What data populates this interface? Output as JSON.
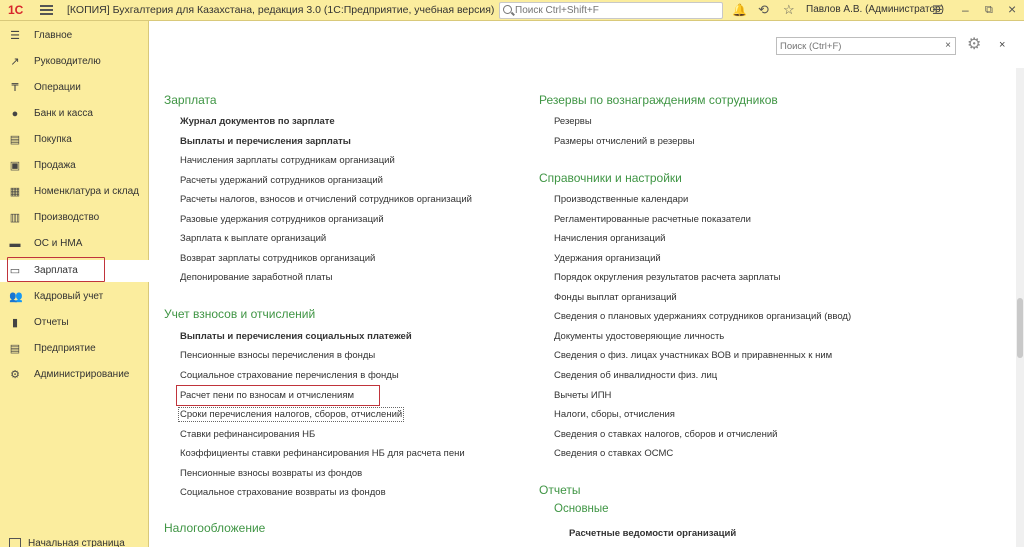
{
  "titlebar": {
    "logo": "1С",
    "title": "[КОПИЯ] Бухгалтерия для Казахстана, редакция 3.0  (1С:Предприятие, учебная версия)",
    "search_placeholder": "Поиск Ctrl+Shift+F",
    "user": "Павлов А.В. (Администратор)",
    "icons": {
      "bell": "🔔",
      "history": "⟲",
      "star": "☆",
      "menu": "☰",
      "minimize": "–",
      "restore": "⧉",
      "close": "×"
    }
  },
  "sidebar": {
    "items": [
      {
        "label": "Главное",
        "icon": "☰"
      },
      {
        "label": "Руководителю",
        "icon": "↗"
      },
      {
        "label": "Операции",
        "icon": "₸"
      },
      {
        "label": "Банк и касса",
        "icon": "●"
      },
      {
        "label": "Покупка",
        "icon": "▤"
      },
      {
        "label": "Продажа",
        "icon": "▣"
      },
      {
        "label": "Номенклатура и склад",
        "icon": "▦"
      },
      {
        "label": "Производство",
        "icon": "▥"
      },
      {
        "label": "ОС и НМА",
        "icon": "▬"
      },
      {
        "label": "Зарплата",
        "icon": "▭"
      },
      {
        "label": "Кадровый учет",
        "icon": "👥"
      },
      {
        "label": "Отчеты",
        "icon": "▮"
      },
      {
        "label": "Предприятие",
        "icon": "▤"
      },
      {
        "label": "Администрирование",
        "icon": "⚙"
      }
    ],
    "home_tab": "Начальная страница"
  },
  "main": {
    "search_placeholder": "Поиск (Ctrl+F)",
    "search_clear": "×",
    "gear": "⚙",
    "close": "×",
    "left": {
      "salary": {
        "title": "Зарплата",
        "links": [
          "Журнал документов по зарплате",
          "Выплаты и перечисления зарплаты",
          "Начисления зарплаты сотрудникам организаций",
          "Расчеты удержаний сотрудников организаций",
          "Расчеты налогов, взносов и отчислений сотрудников организаций",
          "Разовые удержания сотрудников организаций",
          "Зарплата к выплате организаций",
          "Возврат зарплаты сотрудников организаций",
          "Депонирование заработной платы"
        ]
      },
      "contrib": {
        "title": "Учет взносов и отчислений",
        "links": [
          "Выплаты и перечисления социальных платежей",
          "Пенсионные взносы перечисления в фонды",
          "Социальное страхование перечисления в фонды",
          "Расчет пени по взносам и отчислениям",
          "Сроки перечисления налогов, сборов, отчислений",
          "Ставки рефинансирования НБ",
          "Коэффициенты ставки рефинансирования НБ для расчета пени",
          "Пенсионные взносы возвраты из фондов",
          "Социальное страхование возвраты из фондов"
        ]
      },
      "tax": {
        "title": "Налогообложение"
      }
    },
    "right": {
      "reserves": {
        "title": "Резервы по вознаграждениям сотрудников",
        "links": [
          "Резервы",
          "Размеры отчислений в резервы"
        ]
      },
      "refs": {
        "title": "Справочники и настройки",
        "links": [
          "Производственные календари",
          "Регламентированные расчетные показатели",
          "Начисления организаций",
          "Удержания организаций",
          "Порядок округления результатов расчета зарплаты",
          "Фонды выплат организаций",
          "Сведения о плановых удержаниях сотрудников организаций (ввод)",
          "Документы удостоверяющие личность",
          "Сведения о физ. лицах участниках ВОВ и приравненных к ним",
          "Сведения об инвалидности физ. лиц",
          "Вычеты ИПН",
          "Налоги, сборы, отчисления",
          "Сведения о ставках налогов, сборов и отчислений",
          "Сведения о ставках ОСМС"
        ]
      },
      "reports": {
        "title": "Отчеты",
        "subtitle": "Основные",
        "links": [
          "Расчетные ведомости организаций"
        ]
      }
    }
  }
}
